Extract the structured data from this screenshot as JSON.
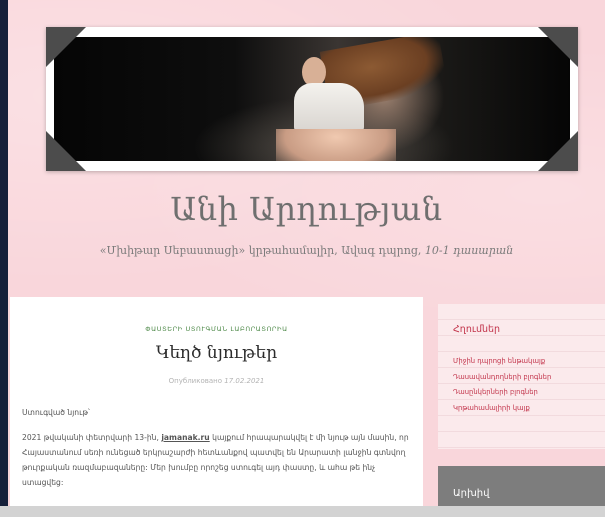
{
  "site": {
    "title": "Անի Արղության",
    "description_main": "«Մխիթար Սեբաստացի» կրթահամալիր, Ավագ դպրոց, ",
    "description_class": "10-1 դասարան"
  },
  "post": {
    "categories": "ՓԱՍՏԵՐԻ ՍՏՈՒԳՄԱՆ ԼԱԲՈՐԱՏՈՐԻԱ",
    "title": "Կեղծ նյութեր",
    "date_label": "Опубликовано",
    "date": "17.02.2021",
    "paragraph1": "Ստուգված նյութ՝",
    "paragraph2_start": "2021 թվականի փետրվարի 13-ին, ",
    "paragraph2_link": "jamanak.ru",
    "paragraph2_rest": " կայքում հրապարակվել է մի նյութ այն մասին, որ Հայաստանում սեռի ունեցած երկրաշարժի հետևանքով պատվել են Արարատի լանջին գտնվող թուրքական ռազմաբազաները: Մեր խումբը որոշեց ստուգել այդ փաստը, և ահա թե ինչ ստացվեց:"
  },
  "sidebar": {
    "links_title": "Հղումներ",
    "links": [
      "Միջին դպրոցի ենթակայք",
      "Դասավանդողների բլոգներ",
      "Դասընկերների բլոգներ",
      "Կրթահամալիրի կայք"
    ],
    "archive_title": "Արխիվ"
  },
  "colors": {
    "page_background": "#f9d6db",
    "accent": "#c2334a",
    "category_green": "#4f8a4a"
  }
}
